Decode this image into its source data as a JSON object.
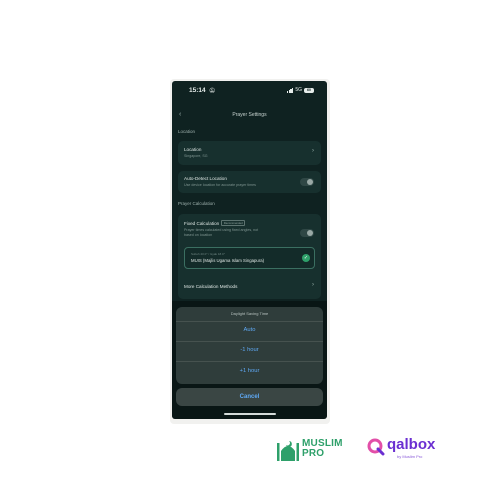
{
  "status_bar": {
    "time": "15:14",
    "network": "5G",
    "battery": "60"
  },
  "nav": {
    "title": "Prayer Settings"
  },
  "location_section": {
    "label": "Location",
    "location_row": {
      "title": "Location",
      "value": "Singapore, SG"
    },
    "auto_detect_row": {
      "title": "Auto-Detect Location",
      "subtitle": "Use device location for accurate prayer times"
    }
  },
  "calculation_section": {
    "label": "Prayer Calculation",
    "fixed_row": {
      "title": "Fixed Calculation",
      "badge": "Recommended",
      "subtitle_line1": "Prayer times calculated using fixed angles, not",
      "subtitle_line2": "based on location"
    },
    "selected_method": {
      "tag": "Subuh 20.0° / Isyak 18.0°",
      "name": "MUIS (Majlis Ugama Islam Singapura)"
    },
    "more_methods_row": {
      "title": "More Calculation Methods"
    }
  },
  "action_sheet": {
    "title": "Daylight Saving Time",
    "options": [
      "Auto",
      "-1 hour",
      "+1 hour"
    ],
    "cancel_label": "Cancel"
  },
  "logos": {
    "muslimpro_line1": "MUSLIM",
    "muslimpro_line2": "PRO",
    "qalbox_name": "qalbox",
    "qalbox_sub": "by Muslim Pro"
  },
  "colors": {
    "background": "#0f2221",
    "card": "#17302e",
    "accent_green": "#2ea06a",
    "ios_blue": "#5fa9f5",
    "qalbox_purple": "#6b2fd1"
  },
  "icons": [
    "back-chevron-icon",
    "chevron-right-icon",
    "checkmark-icon",
    "bell-slash-icon",
    "signal-icon",
    "battery-icon",
    "mosque-icon",
    "qalbox-q-icon"
  ]
}
